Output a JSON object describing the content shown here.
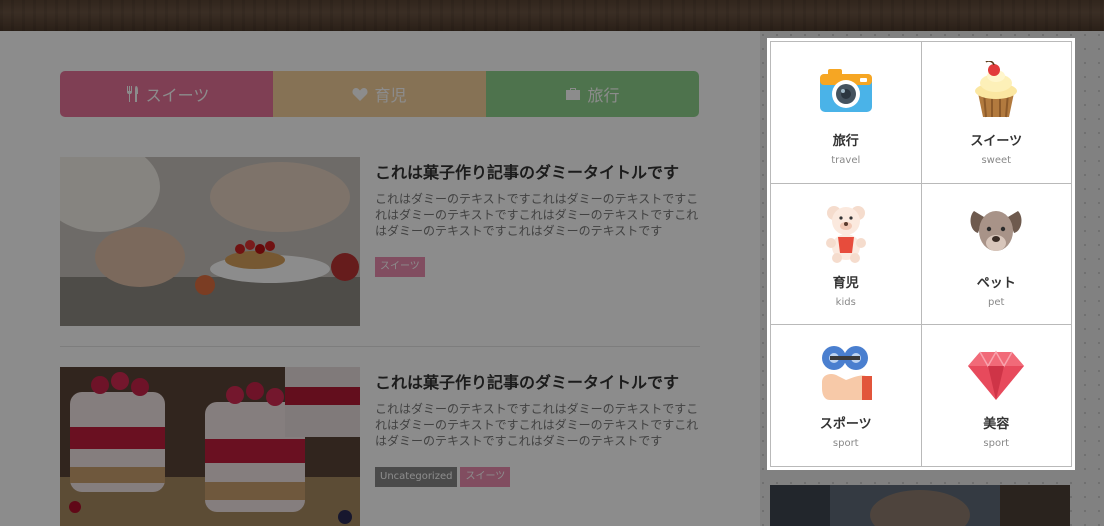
{
  "tabs": [
    {
      "label": "スイーツ",
      "icon": "fork-knife-icon",
      "color": "#e8739a"
    },
    {
      "label": "育児",
      "icon": "heart-icon",
      "color": "#f5cf9c"
    },
    {
      "label": "旅行",
      "icon": "suitcase-icon",
      "color": "#8fd28c"
    }
  ],
  "posts": [
    {
      "title": "これは菓子作り記事のダミータイトルです",
      "excerpt": "これはダミーのテキストですこれはダミーのテキストですこれはダミーのテキストですこれはダミーのテキストですこれはダミーのテキストですこれはダミーのテキストです",
      "tags": [
        "スイーツ"
      ]
    },
    {
      "title": "これは菓子作り記事のダミータイトルです",
      "excerpt": "これはダミーのテキストですこれはダミーのテキストですこれはダミーのテキストですこれはダミーのテキストですこれはダミーのテキストですこれはダミーのテキストです",
      "tags": [
        "Uncategorized",
        "スイーツ"
      ]
    }
  ],
  "categories": [
    {
      "name": "旅行",
      "sub": "travel",
      "icon": "camera-icon"
    },
    {
      "name": "スイーツ",
      "sub": "sweet",
      "icon": "cupcake-icon"
    },
    {
      "name": "育児",
      "sub": "kids",
      "icon": "teddy-bear-icon"
    },
    {
      "name": "ペット",
      "sub": "pet",
      "icon": "dog-icon"
    },
    {
      "name": "スポーツ",
      "sub": "sport",
      "icon": "dumbbell-icon"
    },
    {
      "name": "美容",
      "sub": "sport",
      "icon": "gem-icon"
    }
  ],
  "colors": {
    "overlay": "rgba(0,0,0,0.45)",
    "tag_pink": "#eb8db0",
    "tag_gray": "#888888"
  }
}
